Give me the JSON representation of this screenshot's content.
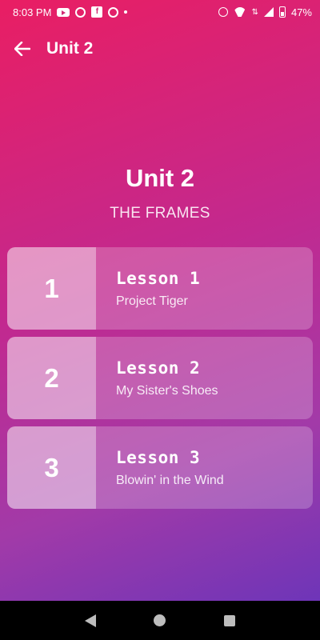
{
  "status_bar": {
    "time": "8:03 PM",
    "battery": "47%",
    "left_icons": [
      "youtube-icon",
      "opera-icon",
      "facebook-icon",
      "fc-icon",
      "dot-icon"
    ],
    "right_icons": [
      "alarm-icon",
      "wifi-icon",
      "data-arrows-icon",
      "signal-icon",
      "battery-icon"
    ]
  },
  "app_bar": {
    "back_icon": "arrow-back-icon",
    "title": "Unit 2"
  },
  "header": {
    "title": "Unit 2",
    "subtitle": "THE FRAMES"
  },
  "lessons": [
    {
      "number": "1",
      "label": "Lesson 1",
      "name": "Project Tiger"
    },
    {
      "number": "2",
      "label": "Lesson 2",
      "name": "My Sister's Shoes"
    },
    {
      "number": "3",
      "label": "Lesson 3",
      "name": "Blowin' in the Wind"
    }
  ],
  "nav_bar": {
    "icons": [
      "nav-back-icon",
      "nav-home-icon",
      "nav-recents-icon"
    ]
  },
  "colors": {
    "gradient_start": "#e91e63",
    "gradient_end": "#6e35b8",
    "nav_bar": "#000000"
  }
}
